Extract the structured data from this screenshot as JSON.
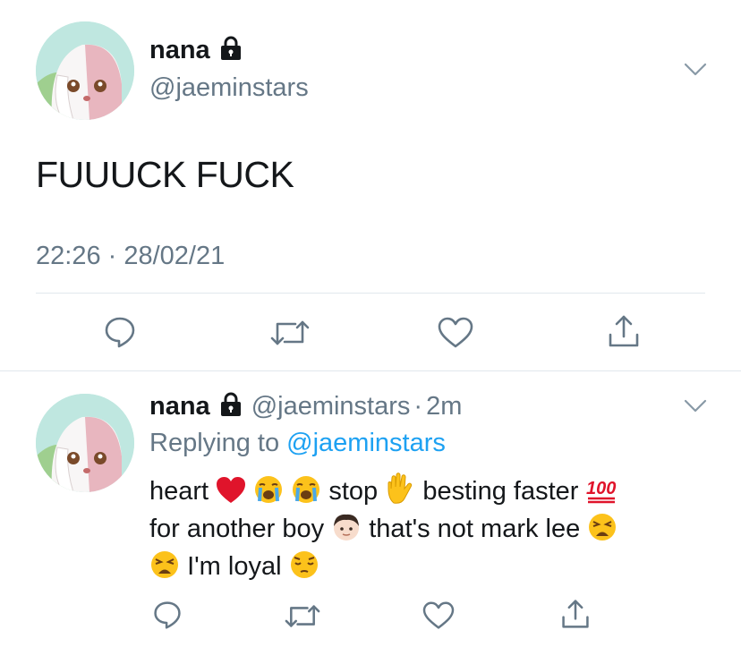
{
  "main_tweet": {
    "display_name": "nana",
    "handle": "@jaeminstars",
    "text": "FUUUCK FUCK",
    "timestamp": "22:26 · 28/02/21"
  },
  "reply_tweet": {
    "display_name": "nana",
    "handle": "@jaeminstars",
    "separator": "·",
    "time_ago": "2m",
    "replying_to_prefix": "Replying to",
    "replying_to_handle": "@jaeminstars",
    "line1": {
      "part1": "heart",
      "part2": "stop",
      "part3": "besting faster"
    },
    "line2": {
      "part1": "for another boy",
      "part2": "that's not mark lee"
    },
    "line3": {
      "part1": "I'm loyal"
    }
  },
  "icons": {
    "lock": "lock-icon",
    "chevron": "chevron-down-icon",
    "reply": "reply-icon",
    "retweet": "retweet-icon",
    "like": "like-icon",
    "share": "share-icon"
  },
  "colors": {
    "text": "#14171a",
    "secondary": "#657786",
    "link": "#1da1f2",
    "divider": "#e1e8ed"
  }
}
